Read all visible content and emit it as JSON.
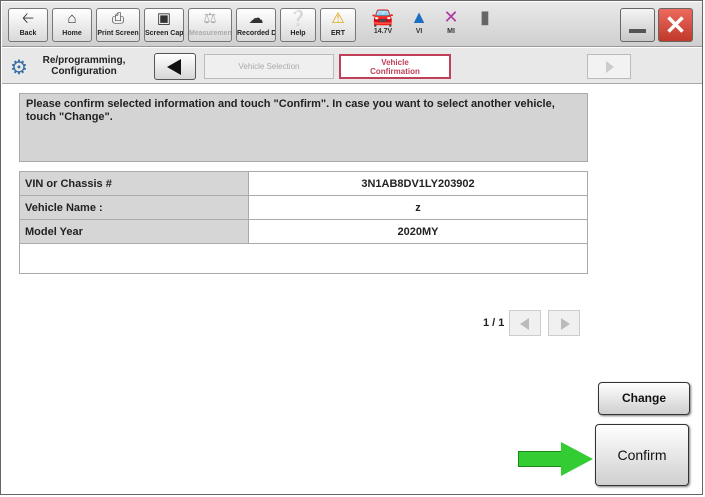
{
  "toolbar": {
    "back": "Back",
    "home": "Home",
    "print_screen": "Print Screen",
    "screen_capture": "Screen Capture",
    "measurement_mode": "Measurement of Mode",
    "recorded_data": "Recorded Data",
    "help": "Help",
    "ert": "ERT",
    "voltage": "14.7V",
    "vi": "VI",
    "mi": "MI"
  },
  "breadcrumb": {
    "home_line1": "Re/programming,",
    "home_line2": "Configuration",
    "step_vehicle_selection": "Vehicle Selection",
    "step_confirm_line1": "Vehicle",
    "step_confirm_line2": "Confirmation"
  },
  "instruction": "Please confirm selected information and touch \"Confirm\". In case you want to select another vehicle, touch \"Change\".",
  "vehicle_info": [
    {
      "label": "VIN or Chassis #",
      "value": "3N1AB8DV1LY203902"
    },
    {
      "label": "Vehicle Name :",
      "value": "z"
    },
    {
      "label": "Model Year",
      "value": "2020MY"
    }
  ],
  "pager": "1 / 1",
  "buttons": {
    "change": "Change",
    "confirm": "Confirm"
  },
  "colors": {
    "accent_step": "#c0405a",
    "arrow": "#33cc33",
    "close": "#c0392b"
  }
}
